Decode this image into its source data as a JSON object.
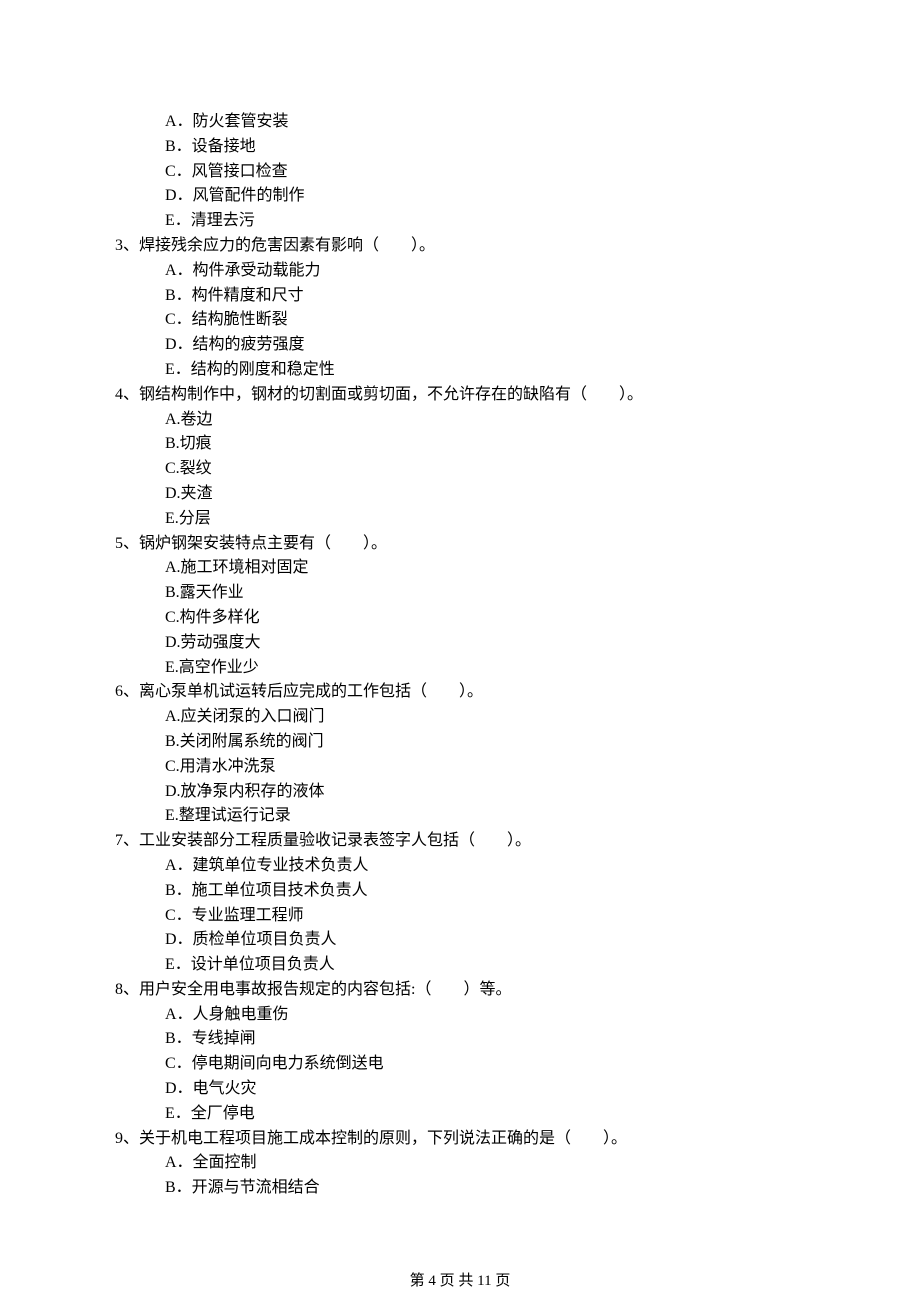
{
  "orphan_options": [
    "A．防火套管安装",
    "B．设备接地",
    "C．风管接口检查",
    "D．风管配件的制作",
    "E．清理去污"
  ],
  "questions": [
    {
      "stem": "3、焊接残余应力的危害因素有影响（　　）。",
      "options": [
        "A．构件承受动载能力",
        "B．构件精度和尺寸",
        "C．结构脆性断裂",
        "D．结构的疲劳强度",
        "E．结构的刚度和稳定性"
      ]
    },
    {
      "stem": "4、钢结构制作中，钢材的切割面或剪切面，不允许存在的缺陷有（　　）。",
      "options": [
        "A.卷边",
        "B.切痕",
        "C.裂纹",
        "D.夹渣",
        "E.分层"
      ]
    },
    {
      "stem": "5、锅炉钢架安装特点主要有（　　）。",
      "options": [
        "A.施工环境相对固定",
        "B.露天作业",
        "C.构件多样化",
        "D.劳动强度大",
        "E.高空作业少"
      ]
    },
    {
      "stem": "6、离心泵单机试运转后应完成的工作包括（　　）。",
      "options": [
        "A.应关闭泵的入口阀门",
        "B.关闭附属系统的阀门",
        "C.用清水冲洗泵",
        "D.放净泵内积存的液体",
        "E.整理试运行记录"
      ]
    },
    {
      "stem": "7、工业安装部分工程质量验收记录表签字人包括（　　）。",
      "options": [
        "A．建筑单位专业技术负责人",
        "B．施工单位项目技术负责人",
        "C．专业监理工程师",
        "D．质检单位项目负责人",
        "E．设计单位项目负责人"
      ]
    },
    {
      "stem": "8、用户安全用电事故报告规定的内容包括:（　　）等。",
      "options": [
        "A．人身触电重伤",
        "B．专线掉闸",
        "C．停电期间向电力系统倒送电",
        "D．电气火灾",
        "E．全厂停电"
      ]
    },
    {
      "stem": "9、关于机电工程项目施工成本控制的原则，下列说法正确的是（　　）。",
      "options": [
        "A．全面控制",
        "B．开源与节流相结合"
      ]
    }
  ],
  "footer": "第 4 页 共 11 页"
}
